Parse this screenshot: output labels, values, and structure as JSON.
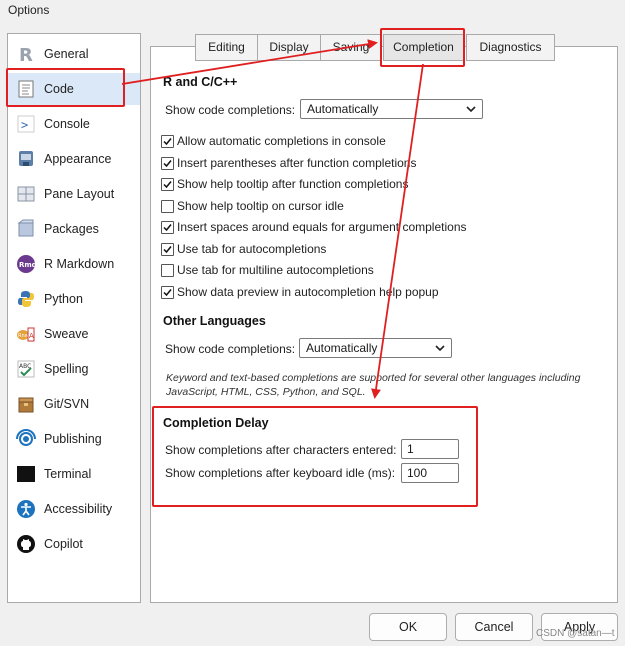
{
  "window": {
    "title": "Options"
  },
  "sidebar": {
    "items": [
      {
        "label": "General",
        "icon": "r-logo-icon",
        "selected": false
      },
      {
        "label": "Code",
        "icon": "code-document-icon",
        "selected": true
      },
      {
        "label": "Console",
        "icon": "console-prompt-icon",
        "selected": false
      },
      {
        "label": "Appearance",
        "icon": "appearance-palette-icon",
        "selected": false
      },
      {
        "label": "Pane Layout",
        "icon": "pane-layout-icon",
        "selected": false
      },
      {
        "label": "Packages",
        "icon": "packages-box-icon",
        "selected": false
      },
      {
        "label": "R Markdown",
        "icon": "rmarkdown-icon",
        "selected": false
      },
      {
        "label": "Python",
        "icon": "python-icon",
        "selected": false
      },
      {
        "label": "Sweave",
        "icon": "sweave-icon",
        "selected": false
      },
      {
        "label": "Spelling",
        "icon": "spelling-abc-icon",
        "selected": false
      },
      {
        "label": "Git/SVN",
        "icon": "git-box-icon",
        "selected": false
      },
      {
        "label": "Publishing",
        "icon": "publishing-icon",
        "selected": false
      },
      {
        "label": "Terminal",
        "icon": "terminal-icon",
        "selected": false
      },
      {
        "label": "Accessibility",
        "icon": "accessibility-icon",
        "selected": false
      },
      {
        "label": "Copilot",
        "icon": "github-icon",
        "selected": false
      }
    ]
  },
  "tabs": [
    {
      "label": "Editing",
      "active": false
    },
    {
      "label": "Display",
      "active": false
    },
    {
      "label": "Saving",
      "active": false
    },
    {
      "label": "Completion",
      "active": true
    },
    {
      "label": "Diagnostics",
      "active": false
    }
  ],
  "r_section": {
    "heading": "R and C/C++",
    "show_label": "Show code completions:",
    "show_value": "Automatically",
    "options": [
      {
        "label": "Allow automatic completions in console",
        "checked": true
      },
      {
        "label": "Insert parentheses after function completions",
        "checked": true
      },
      {
        "label": "Show help tooltip after function completions",
        "checked": true
      },
      {
        "label": "Show help tooltip on cursor idle",
        "checked": false
      },
      {
        "label": "Insert spaces around equals for argument completions",
        "checked": true
      },
      {
        "label": "Use tab for autocompletions",
        "checked": true
      },
      {
        "label": "Use tab for multiline autocompletions",
        "checked": false
      },
      {
        "label": "Show data preview in autocompletion help popup",
        "checked": true
      }
    ]
  },
  "other_section": {
    "heading": "Other Languages",
    "show_label": "Show code completions:",
    "show_value": "Automatically",
    "note": "Keyword and text-based completions are supported for several other languages including JavaScript, HTML, CSS, Python, and SQL."
  },
  "delay_section": {
    "heading": "Completion Delay",
    "chars_label": "Show completions after characters entered:",
    "chars_value": "1",
    "idle_label": "Show completions after keyboard idle (ms):",
    "idle_value": "100"
  },
  "buttons": {
    "ok": "OK",
    "cancel": "Cancel",
    "apply": "Apply"
  },
  "watermark": "CSDN @satan—t",
  "annotation_color": "#e02020"
}
